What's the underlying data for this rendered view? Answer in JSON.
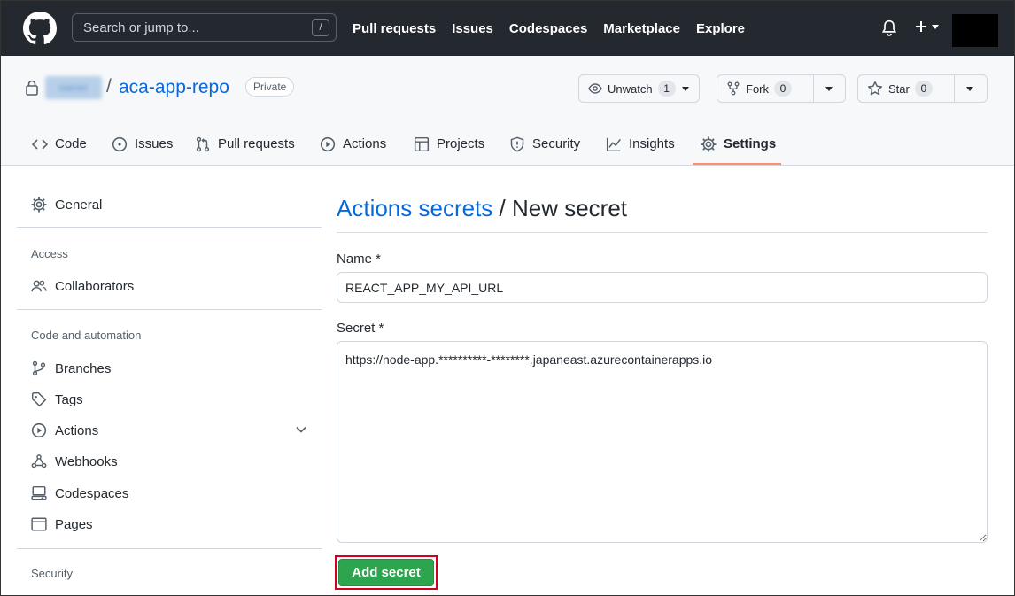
{
  "header": {
    "search_placeholder": "Search or jump to...",
    "search_shortcut": "/",
    "nav": [
      "Pull requests",
      "Issues",
      "Codespaces",
      "Marketplace",
      "Explore"
    ]
  },
  "repo": {
    "owner": "owner",
    "separator": "/",
    "name": "aca-app-repo",
    "visibility": "Private",
    "watch_label": "Unwatch",
    "watch_count": "1",
    "fork_label": "Fork",
    "fork_count": "0",
    "star_label": "Star",
    "star_count": "0",
    "tabs": [
      "Code",
      "Issues",
      "Pull requests",
      "Actions",
      "Projects",
      "Security",
      "Insights",
      "Settings"
    ],
    "active_tab": "Settings"
  },
  "sidebar": {
    "general": "General",
    "access_heading": "Access",
    "collaborators": "Collaborators",
    "code_heading": "Code and automation",
    "items": [
      "Branches",
      "Tags",
      "Actions",
      "Webhooks",
      "Codespaces",
      "Pages"
    ],
    "security_heading": "Security"
  },
  "main": {
    "crumb_link": "Actions secrets",
    "crumb_rest": " / New secret",
    "name_label": "Name *",
    "name_value": "REACT_APP_MY_API_URL",
    "secret_label": "Secret *",
    "secret_value": "https://node-app.**********-********.japaneast.azurecontainerapps.io",
    "submit_label": "Add secret"
  },
  "colors": {
    "header_bg": "#24292f",
    "link": "#0969da",
    "primary_button": "#2da44e",
    "highlight_border": "#d0021b",
    "tab_underline": "#fd8c73"
  }
}
